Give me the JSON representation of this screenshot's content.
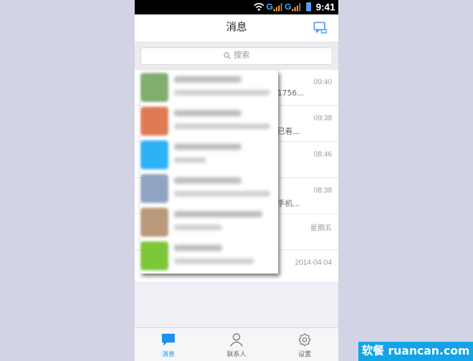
{
  "status_bar": {
    "carrier1": "G",
    "carrier2": "G",
    "time": "9:41"
  },
  "header": {
    "title": "消息",
    "compose_icon": "compose-icon"
  },
  "search": {
    "placeholder": "搜索",
    "icon": "search-icon"
  },
  "conversations": [
    {
      "time": "09:40",
      "preview_tail": "1756..."
    },
    {
      "time": "09:38",
      "preview_tail": "已看..."
    },
    {
      "time": "08:46",
      "preview_tail": ""
    },
    {
      "time": "08:38",
      "preview_tail": "手机..."
    },
    {
      "time": "星期五",
      "preview_tail": ""
    },
    {
      "time": "2014-04-04",
      "preview_tail": ""
    }
  ],
  "preview_avatars": [
    {
      "color": "#7fae6e"
    },
    {
      "color": "#e07a55"
    },
    {
      "color": "#2fb1f5"
    },
    {
      "color": "#8fa3c3"
    },
    {
      "color": "#b89a7a"
    },
    {
      "color": "#7cc63a"
    }
  ],
  "tabs": [
    {
      "label": "消息",
      "icon": "chat-bubble-icon",
      "active": true
    },
    {
      "label": "联系人",
      "icon": "person-icon",
      "active": false
    },
    {
      "label": "设置",
      "icon": "gear-icon",
      "active": false
    }
  ],
  "watermark": "软餐 ruancan.com",
  "colors": {
    "accent": "#1f8ff2",
    "watermark_bg": "#13a3e6"
  }
}
